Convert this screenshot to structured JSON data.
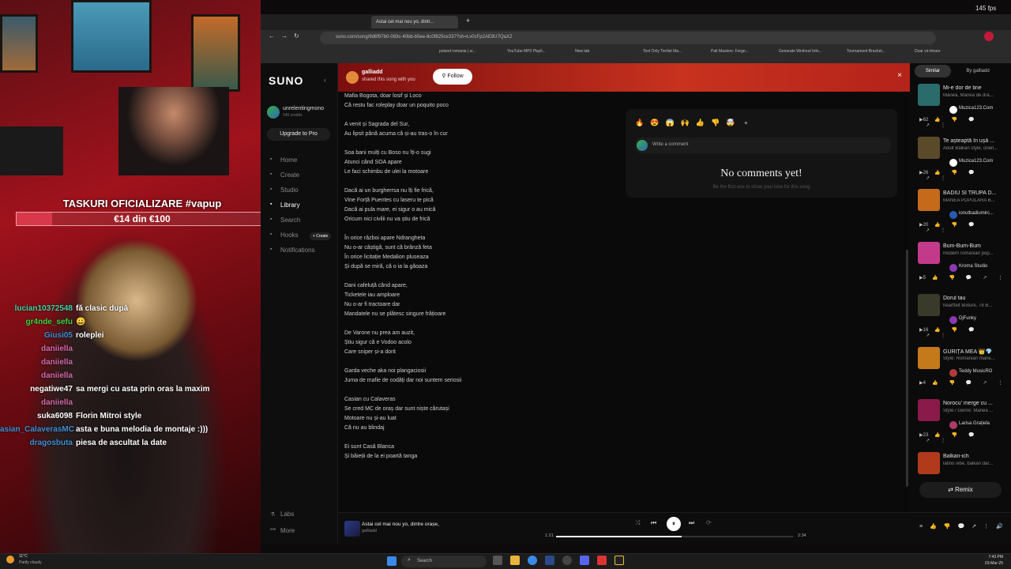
{
  "stream": {
    "tasks_title": "TASKURI OFICIALIZARE #vapup",
    "donation": "€14 din €100",
    "donation_fraction": 0.14,
    "chat": [
      {
        "user": "lucian10372548",
        "color": "#3fd3a0",
        "msg": "fă clasic după"
      },
      {
        "user": "gr4nde_sefu",
        "color": "#3fd33f",
        "msg": "😀"
      },
      {
        "user": "Giusi05",
        "color": "#3f8fd3",
        "msg": "roleplei"
      },
      {
        "user": "daniiella",
        "color": "#d36aa8",
        "msg": ""
      },
      {
        "user": "daniiella",
        "color": "#d36aa8",
        "msg": ""
      },
      {
        "user": "daniiella",
        "color": "#d36aa8",
        "msg": ""
      },
      {
        "user": "negatiwe47",
        "color": "#ffffff",
        "msg": "sa mergi cu asta prin oras la maxim"
      },
      {
        "user": "daniiella",
        "color": "#d36aa8",
        "msg": ""
      },
      {
        "user": "suka6098",
        "color": "#ffffff",
        "msg": "Florin Mitroi style"
      },
      {
        "user": "asian_CalaverasMC",
        "color": "#3f8fd3",
        "msg": "asta e buna melodia de montaje :)))"
      },
      {
        "user": "dragosbuta",
        "color": "#3f8fd3",
        "msg": "piesa de ascultat la date"
      }
    ]
  },
  "browser": {
    "tab_title": "Astai cel mai nou yo, dintr...",
    "url": "suno.com/song/9d6f97b0-083c-40bb-b5ee-8c0f825ce337?sh=Lv0cFp2AE9U7QaX2",
    "fps": "145 fps",
    "bookmarks": [
      "poland romania | ui...",
      "YouTube MP3 Playli...",
      "New tab",
      "Text Only Tierlist Ma...",
      "Pait Masters: Forge...",
      "Generate Workout Info...",
      "Tournament Bracket...",
      "Doar vii intrare"
    ]
  },
  "sidebar": {
    "logo": "SUNO",
    "user": "unrelentingmono",
    "credits": "140 credits",
    "upgrade": "Upgrade to Pro",
    "nav": [
      {
        "label": "Home",
        "icon": "home-icon"
      },
      {
        "label": "Create",
        "icon": "create-icon"
      },
      {
        "label": "Studio",
        "icon": "studio-icon"
      },
      {
        "label": "Library",
        "icon": "library-icon"
      },
      {
        "label": "Search",
        "icon": "search-icon"
      },
      {
        "label": "Hooks",
        "icon": "hooks-icon"
      },
      {
        "label": "Notifications",
        "icon": "bell-icon"
      }
    ],
    "hooks_create": "+ Create",
    "labs": "Labs",
    "more": "More"
  },
  "banner": {
    "user": "galliadd",
    "subtitle": "shared this song with you",
    "follow": "Follow"
  },
  "lyrics": [
    "Mafia Bogota, doar losif și Loco",
    "Că restu fac roleplay doar un poquito poco",
    "",
    "A venit și Sagrada del Sur,",
    "Au lipsit până acuma că și-au tras-o în cur",
    "",
    "Soa bani mulți cu Boso nu îți-o sugi",
    "Atunci când SOA apare",
    "Le faci schimbu de ulei la motoare",
    "",
    "Dacă ai un burgherrsa nu îți fie frică,",
    "Vine Forță Puentes cu laseru te pică",
    "Dacă ai pula mare, ei sigur o au mică",
    "Oricum nici civilii nu va știu de frică",
    "",
    "În orice război apare Ndrangheta",
    "Nu o-ar câștigă, sunt că brânză feta",
    "În orice licitație Medalion pluseaza",
    "Și după se miră, că o ia la găoaza",
    "",
    "Dani cafeluță când apare,",
    "Ticketele iau amploare",
    "Nu o-ar fi tractoare dar",
    "Mandatele nu se plătesc singure frățioare",
    "",
    "De Varone nu prea am auzit,",
    "Știu sigur că e Vodoo acolo",
    "Care sniper și-a dorit",
    "",
    "Garda veche aka noi plangaciosii",
    "Juma de mafie de codăți dar noi suntem seriosii",
    "",
    "Casian cu Calaveras",
    "Se cred MC de oraș dar sunt niște cărutași",
    "Motoare nu și-au luat",
    "Că nu au blindaj",
    "",
    "Ei sunt Casă Blanca",
    "Și băieții de la ei poartă tanga"
  ],
  "comments": {
    "reactions": [
      "🔥",
      "😍",
      "😱",
      "🙌",
      "👍",
      "👎",
      "🤯"
    ],
    "placeholder": "Write a comment",
    "empty_title": "No comments yet!",
    "empty_sub": "Be the first one to show your love for this song"
  },
  "right": {
    "tabs": [
      "Similar",
      "By galliadd"
    ],
    "items": [
      {
        "title": "Mi-e dor de tine",
        "style": "Manea, Manea de dra...",
        "artist": "Muzica123.Com",
        "plays": "62",
        "thumb": "#2a6b6b",
        "av": "#ffffff"
      },
      {
        "title": "Te așteaptă în ușă ...",
        "style": "Adult Balkan style, orien...",
        "artist": "Muzica123.Com",
        "plays": "26",
        "thumb": "#5a4a2a",
        "av": "#ffffff"
      },
      {
        "title": "BADIU SI TRUPA D...",
        "style": "MANEA POPULARA B...",
        "artist": "ionutbadiumirc...",
        "plays": "20",
        "thumb": "#c46a1a",
        "av": "#2a5ab0"
      },
      {
        "title": "Bum-Bum-Bum",
        "style": "modern romanian pop...",
        "artist": "Kroma Studio",
        "plays": "5",
        "thumb": "#c43a8a",
        "av": "#8a3ab0"
      },
      {
        "title": "Dorul tau",
        "style": "heartfelt texture, 78 B...",
        "artist": "DjFunky",
        "plays": "16",
        "thumb": "#3a3a2a",
        "av": "#8a3ab0"
      },
      {
        "title": "GURIȚA MEA 👑💎",
        "style": "Style: Romanian mane...",
        "artist": "Teddy MusicRO",
        "plays": "4",
        "thumb": "#c47a1a",
        "av": "#b03a3a"
      },
      {
        "title": "Norocu' merge cu ...",
        "style": "Style / Genre: Manea ...",
        "artist": "Larisa Grațiela",
        "plays": "23",
        "thumb": "#8a1a4a",
        "av": "#b03a6a"
      },
      {
        "title": "Balkan-ich",
        "style": "latino vibe, balkan dar...",
        "artist": "",
        "plays": "",
        "thumb": "#b03a1a",
        "av": "#ffffff"
      }
    ],
    "remix": "Remix"
  },
  "player": {
    "title": "Astai cel mai nou yo, dintre orașe,",
    "artist": "galliadd",
    "elapsed": "1:21",
    "duration": "2:34",
    "progress": 0.53
  },
  "taskbar": {
    "weather_temp": "11°C",
    "weather_desc": "Partly cloudy",
    "search": "Search",
    "time": "7:43 PM",
    "date": "03-Mar-25"
  }
}
